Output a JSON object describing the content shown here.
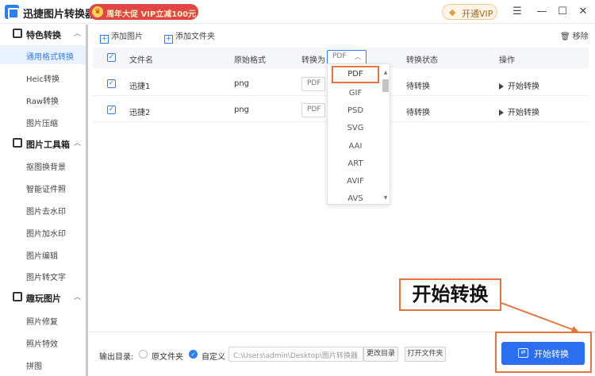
{
  "window": {
    "title": "迅捷图片转换器",
    "promo": "周年大促 VIP立减100元",
    "vip_label": "开通VIP"
  },
  "sidebar": {
    "groups": [
      {
        "label": "特色转换",
        "items": [
          "通用格式转换",
          "Heic转换",
          "Raw转换",
          "图片压缩"
        ]
      },
      {
        "label": "图片工具箱",
        "items": [
          "抠图换背景",
          "智能证件照",
          "图片去水印",
          "图片加水印",
          "图片编辑",
          "图片转文字"
        ]
      },
      {
        "label": "趣玩图片",
        "items": [
          "照片修复",
          "照片特效",
          "拼图"
        ]
      }
    ]
  },
  "toolbar": {
    "add_image": "添加图片",
    "add_folder": "添加文件夹",
    "remove": "移除"
  },
  "table": {
    "headers": {
      "filename": "文件名",
      "original_format": "原始格式",
      "convert_to": "转换为",
      "status": "转换状态",
      "action": "操作"
    },
    "header_format_value": "PDF",
    "rows": [
      {
        "filename": "迅捷1",
        "original_format": "png",
        "target": "PDF",
        "status": "待转换",
        "action": "开始转换"
      },
      {
        "filename": "迅捷2",
        "original_format": "png",
        "target": "PDF",
        "status": "待转换",
        "action": "开始转换"
      }
    ]
  },
  "dropdown": {
    "options": [
      "PDF",
      "GIF",
      "PSD",
      "SVG",
      "AAI",
      "ART",
      "AVIF",
      "AVS"
    ],
    "selected": "PDF"
  },
  "output": {
    "label": "输出目录:",
    "option_original": "原文件夹",
    "option_custom": "自定义",
    "path": "C:\\Users\\admin\\Desktop\\图片转换器",
    "change_dir": "更改目录",
    "open_folder": "打开文件夹"
  },
  "start_button": "开始转换",
  "callout": "开始转换",
  "colors": {
    "accent": "#2b7ef6",
    "highlight": "#e8743b",
    "promo": "#e24545"
  }
}
